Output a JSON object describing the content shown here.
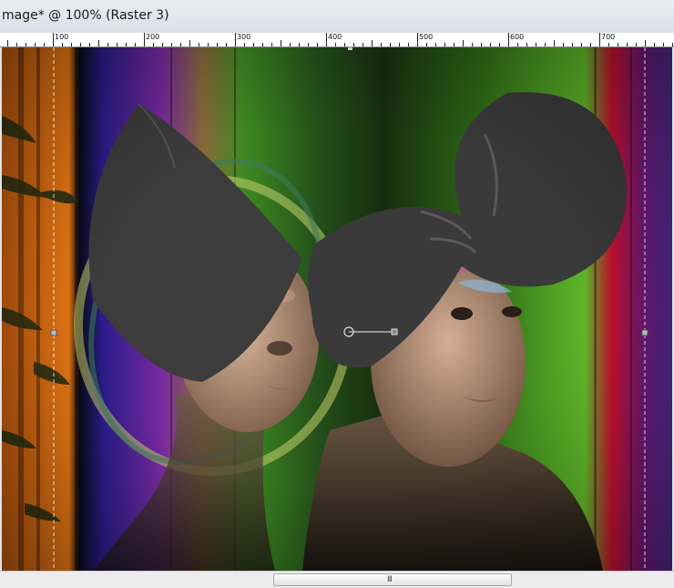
{
  "window": {
    "title": "mage* @ 100% (Raster 3)"
  },
  "ruler": {
    "labels": [
      {
        "text": "100",
        "value": 100
      },
      {
        "text": "200",
        "value": 200
      },
      {
        "text": "300",
        "value": 300
      },
      {
        "text": "400",
        "value": 400
      },
      {
        "text": "500",
        "value": 500
      },
      {
        "text": "600",
        "value": 600
      },
      {
        "text": "700",
        "value": 700
      }
    ]
  },
  "canvas": {
    "description_icon": "image-canvas",
    "colors": {
      "green": "#3e8a22",
      "dark_green": "#172c0f",
      "orange": "#e87814",
      "purple": "#5a229a",
      "blue": "#2a1c8a",
      "red": "#c8102e",
      "hat": "#3c3c3c",
      "skin": "#c9a58b",
      "ring": "#c6cf6c"
    }
  },
  "scrollbar": {
    "grip_icon": "scroll-grip-icon",
    "grip_glyph": "III"
  }
}
